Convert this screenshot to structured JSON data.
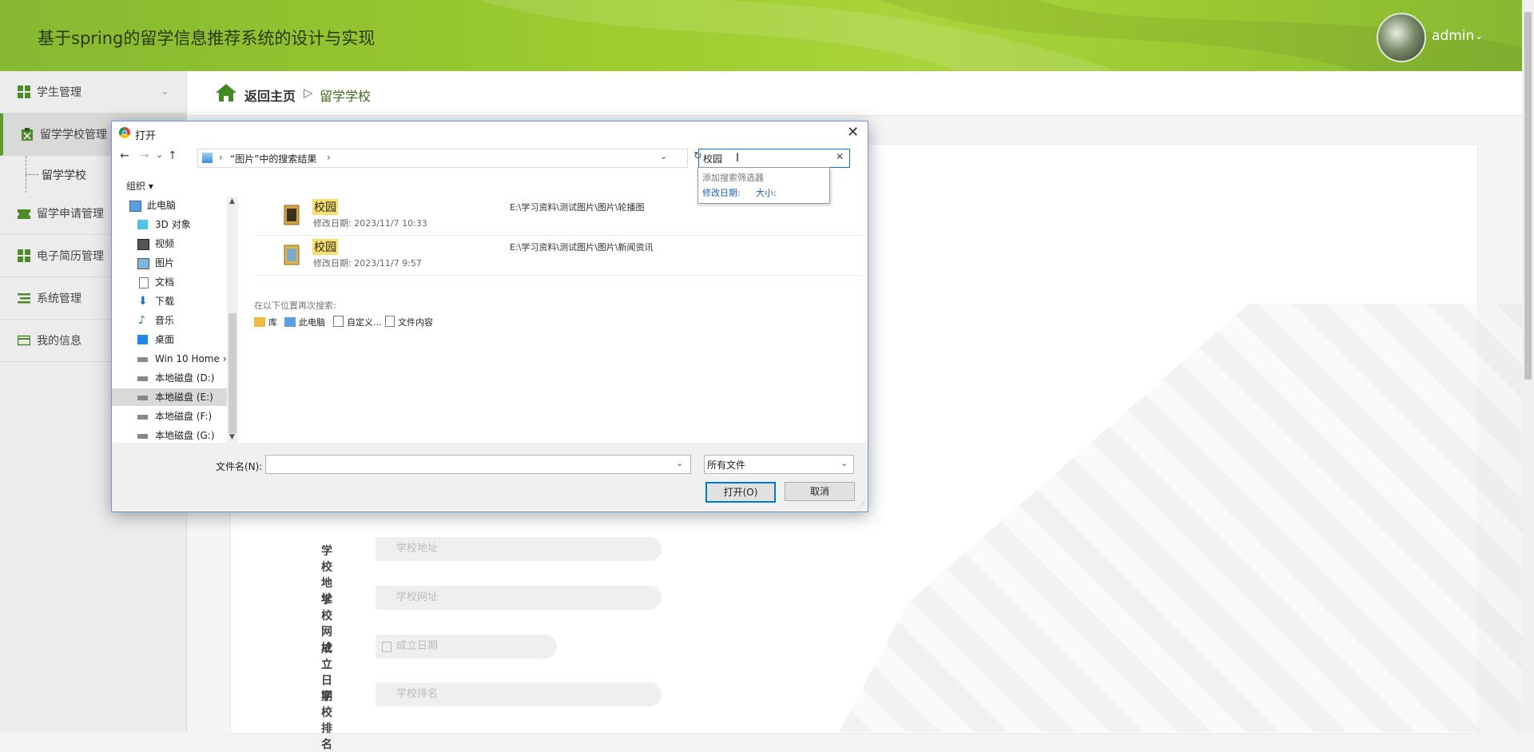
{
  "header": {
    "title": "基于spring的留学信息推荐系统的设计与实现",
    "user": "admin",
    "caret": "⌄"
  },
  "sidebar": {
    "items": [
      {
        "label": "学生管理",
        "icon": "grid-icon",
        "chevron": "⌄"
      },
      {
        "label": "留学学校管理",
        "icon": "clipboard-icon"
      },
      {
        "label": "留学申请管理",
        "icon": "ticket-icon"
      },
      {
        "label": "电子简历管理",
        "icon": "grid-icon"
      },
      {
        "label": "系统管理",
        "icon": "list-icon"
      },
      {
        "label": "我的信息",
        "icon": "card-icon"
      }
    ],
    "sub_item": "留学学校"
  },
  "breadcrumb": {
    "home": "返回主页",
    "separator": "▷",
    "current": "留学学校"
  },
  "form": {
    "rows": [
      {
        "label": "学校地址",
        "placeholder": "学校地址"
      },
      {
        "label": "学校网址",
        "placeholder": "学校网址"
      },
      {
        "label": "成立日期",
        "placeholder": "成立日期"
      },
      {
        "label": "学校排名",
        "placeholder": "学校排名"
      }
    ]
  },
  "dialog": {
    "title": "打开",
    "close": "✕",
    "back": "←",
    "forward": "→",
    "recent": "⌄",
    "up": "↑",
    "address": "“图片”中的搜索结果",
    "address_sep": "›",
    "refresh": "↻",
    "search_value": "校园",
    "search_clear": "✕",
    "suggest_title": "添加搜索筛选器",
    "suggest_date": "修改日期:",
    "suggest_size": "大小:",
    "organize": "组织 ▾",
    "tree": [
      {
        "label": "此电脑",
        "icon": "computer-icon"
      },
      {
        "label": "3D 对象",
        "icon": "cube-icon"
      },
      {
        "label": "视频",
        "icon": "film-icon"
      },
      {
        "label": "图片",
        "icon": "picture-icon"
      },
      {
        "label": "文档",
        "icon": "document-icon"
      },
      {
        "label": "下载",
        "icon": "download-icon"
      },
      {
        "label": "音乐",
        "icon": "music-icon"
      },
      {
        "label": "桌面",
        "icon": "desktop-icon"
      },
      {
        "label": "Win 10 Home ›",
        "icon": "drive-icon"
      },
      {
        "label": "本地磁盘 (D:)",
        "icon": "drive-icon"
      },
      {
        "label": "本地磁盘 (E:)",
        "icon": "drive-icon"
      },
      {
        "label": "本地磁盘 (F:)",
        "icon": "drive-icon"
      },
      {
        "label": "本地磁盘 (G:)",
        "icon": "drive-icon"
      }
    ],
    "results": [
      {
        "name": "校园",
        "meta": "修改日期: 2023/11/7 10:33",
        "path": "E:\\学习资料\\测试图片\\图片\\轮播图"
      },
      {
        "name": "校园",
        "meta": "修改日期: 2023/11/7 9:57",
        "path": "E:\\学习资料\\测试图片\\图片\\新闻资讯"
      }
    ],
    "search_again_title": "在以下位置再次搜索:",
    "search_again": [
      {
        "label": "库",
        "icon": "library-icon"
      },
      {
        "label": "此电脑",
        "icon": "computer-icon"
      },
      {
        "label": "自定义...",
        "icon": "custom-folder-icon"
      },
      {
        "label": "文件内容",
        "icon": "file-content-icon"
      }
    ],
    "filename_label": "文件名(N):",
    "filename_value": "",
    "filetype": "所有文件",
    "open_button": "打开(O)",
    "cancel_button": "取消"
  },
  "colors": {
    "header_green": "#9ccc2e",
    "accent_green": "#3f6d1c",
    "highlight_yellow": "#f8de6c",
    "dialog_blue": "#0078d7"
  }
}
